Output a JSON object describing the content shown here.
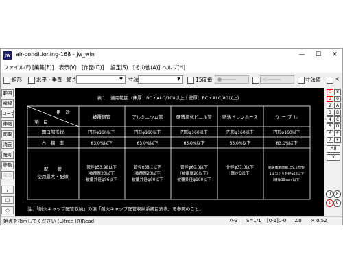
{
  "window": {
    "title": "air-conditioning-168 - jw_win",
    "icon_text": "jw",
    "controls": {
      "minimize": "—",
      "maximize": "☐",
      "close": "✕"
    }
  },
  "menu": [
    "ファイル(F)",
    "[編集(E)]",
    "表示(V)",
    "[作図(D)]",
    "設定(S)",
    "[その他(A)]",
    "ヘルプ(H)"
  ],
  "toolbar": {
    "rect_label": "矩形",
    "hv_label": "水平・垂直",
    "angle_label": "傾き",
    "dim_label": "寸法",
    "deg15_label": "15度毎",
    "disabled1": "●———",
    "disabled2": "<———",
    "dimval_label": "寸法値",
    "tail": "<"
  },
  "left_tools": [
    "範囲",
    "複線",
    "コーナー",
    "伸縮",
    "面取",
    "消去",
    "複写",
    "移動",
    "戻る",
    "/",
    "□",
    "○"
  ],
  "right_tools": {
    "layer_buttons": [
      [
        "0",
        "8"
      ],
      [
        "1",
        "9"
      ],
      [
        "2",
        "A"
      ],
      [
        "3",
        "B"
      ],
      [
        "4",
        "C"
      ],
      [
        "5",
        "D"
      ],
      [
        "6",
        "E"
      ],
      [
        "7",
        "F"
      ]
    ],
    "all_label": "All",
    "x_label": "×",
    "circ_pairs": [
      [
        "0",
        "8"
      ],
      [
        "1",
        "9"
      ]
    ]
  },
  "drawing": {
    "title": "表１　適用範囲（床厚：RC・ALC/100以上｜壁厚：RC・ALC/80以上）",
    "corner_top": "用　途",
    "corner_bottom": "項　目",
    "columns": [
      "被覆銅管",
      "アルミニウム管",
      "硬質塩化ビニル管",
      "断熱ドレンホース",
      "ケ ー ブ ル"
    ],
    "rows": [
      {
        "label": "開口部形状",
        "cells": [
          "円形φ160以下",
          "円形φ160以下",
          "円形φ160以下",
          "円形φ160以下",
          "円形φ160以下"
        ]
      },
      {
        "label": "占　積　率",
        "cells": [
          "63.0%以下",
          "63.0%以下",
          "63.0%以下",
          "63.0%以下",
          "63.0%以下"
        ]
      }
    ],
    "last_row_label": [
      "配　　管",
      "使用最大・配線"
    ],
    "last_row_cells": [
      [
        "管径φ53.98以下",
        "（被覆厚20以下）",
        "被覆外径φ96以下"
      ],
      [
        "管径φ38.1以下",
        "（被覆厚20以下）",
        "被覆外径φ80以下"
      ],
      [
        "管径φ60.0以下",
        "（被覆厚20以下）",
        "被覆外径φ100以下"
      ],
      [
        "外径φ37.0以下",
        "（厚さ6以下）",
        ""
      ],
      [
        "総導体断面積159.5mm²",
        "1本当たり外径φ25以下",
        "（導体38mm²以下）"
      ]
    ],
    "note": "注：「耐火キャップ配管収納」の項「耐火キャップ配管収納系統目安表」を参照のこと。"
  },
  "status": {
    "message": "始点を指示してください (L)free (R)Read",
    "paper": "A-3",
    "scale": "S=1/1",
    "layer": "[0-1]0-0",
    "angle": "∠0",
    "zoom": "× 0.52"
  }
}
